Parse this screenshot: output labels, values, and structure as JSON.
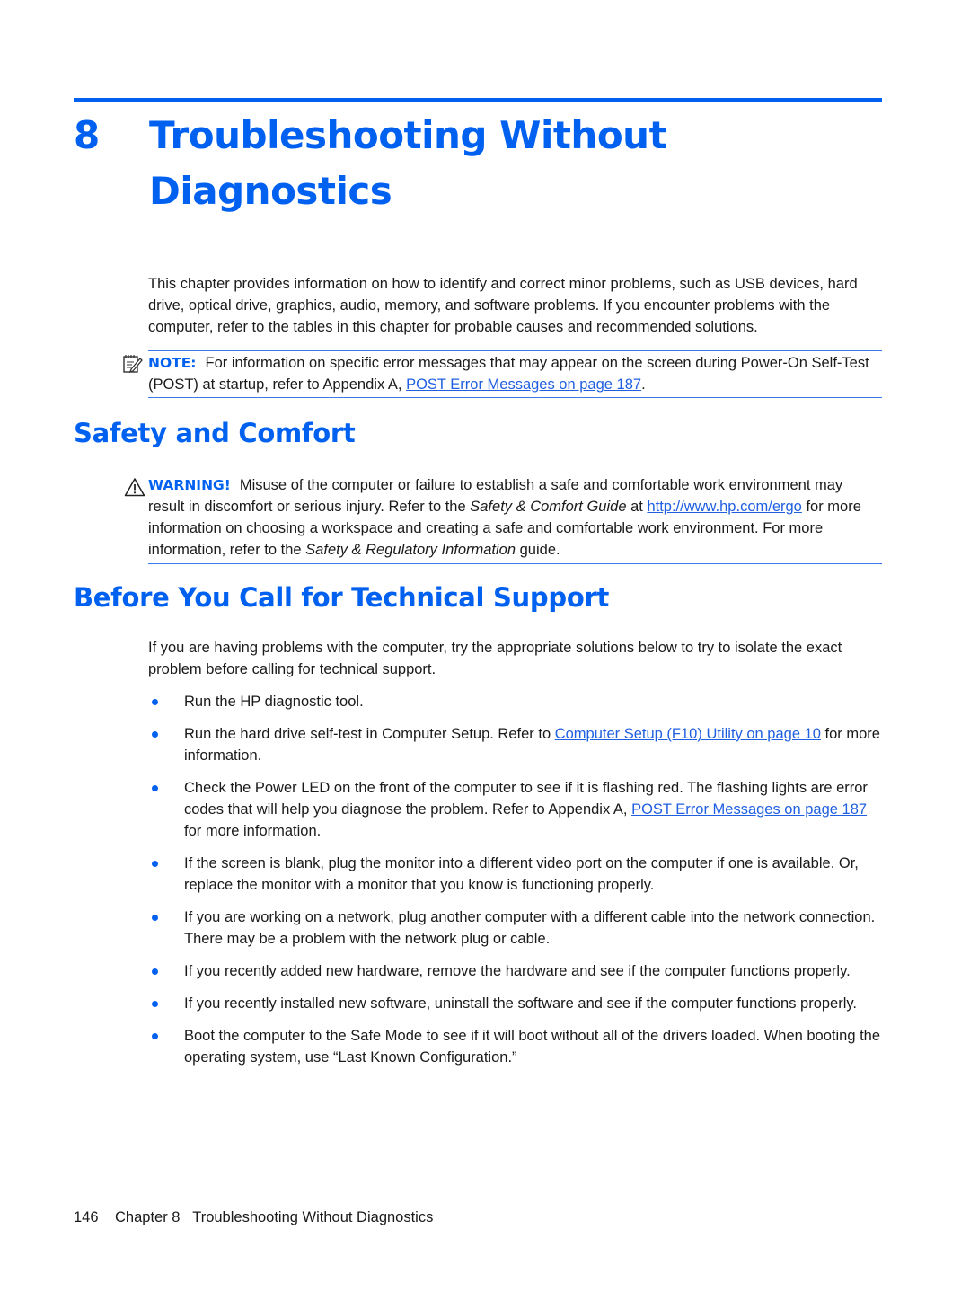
{
  "colors": {
    "accent": "#0060f0",
    "link": "#1f5fe0",
    "text": "#1a1a1a"
  },
  "chapter": {
    "number": "8",
    "title": "Troubleshooting Without Diagnostics"
  },
  "intro": "This chapter provides information on how to identify and correct minor problems, such as USB devices, hard drive, optical drive, graphics, audio, memory, and software problems. If you encounter problems with the computer, refer to the tables in this chapter for probable causes and recommended solutions.",
  "note": {
    "icon": "note-pencil-icon",
    "label": "NOTE:",
    "text_before": "For information on specific error messages that may appear on the screen during Power-On Self-Test (POST) at startup, refer to Appendix A, ",
    "link": "POST Error Messages on page 187",
    "text_after": "."
  },
  "safety": {
    "heading": "Safety and Comfort",
    "warning": {
      "icon": "warning-triangle-icon",
      "label": "WARNING!",
      "text1": "Misuse of the computer or failure to establish a safe and comfortable work environment may result in discomfort or serious injury. Refer to the ",
      "italic1": "Safety & Comfort Guide",
      "text2": " at ",
      "link": "http://www.hp.com/ergo",
      "text3": " for more information on choosing a workspace and creating a safe and comfortable work environment. For more information, refer to the ",
      "italic2": "Safety & Regulatory Information",
      "text4": " guide."
    }
  },
  "before_call": {
    "heading": "Before You Call for Technical Support",
    "intro": "If you are having problems with the computer, try the appropriate solutions below to try to isolate the exact problem before calling for technical support.",
    "items": [
      {
        "text": "Run the HP diagnostic tool."
      },
      {
        "text_before": "Run the hard drive self-test in Computer Setup. Refer to ",
        "link": "Computer Setup (F10) Utility on page 10",
        "text_after": " for more information."
      },
      {
        "text_before": "Check the Power LED on the front of the computer to see if it is flashing red. The flashing lights are error codes that will help you diagnose the problem. Refer to Appendix A, ",
        "link": "POST Error Messages on page 187",
        "text_after": " for more information."
      },
      {
        "text": "If the screen is blank, plug the monitor into a different video port on the computer if one is available. Or, replace the monitor with a monitor that you know is functioning properly."
      },
      {
        "text": "If you are working on a network, plug another computer with a different cable into the network connection. There may be a problem with the network plug or cable."
      },
      {
        "text": "If you recently added new hardware, remove the hardware and see if the computer functions properly."
      },
      {
        "text": "If you recently installed new software, uninstall the software and see if the computer functions properly."
      },
      {
        "text": "Boot the computer to the Safe Mode to see if it will boot without all of the drivers loaded. When booting the operating system, use “Last Known Configuration.”"
      }
    ]
  },
  "footer": {
    "page_number": "146",
    "chapter_label": "Chapter 8",
    "chapter_title": "Troubleshooting Without Diagnostics"
  }
}
